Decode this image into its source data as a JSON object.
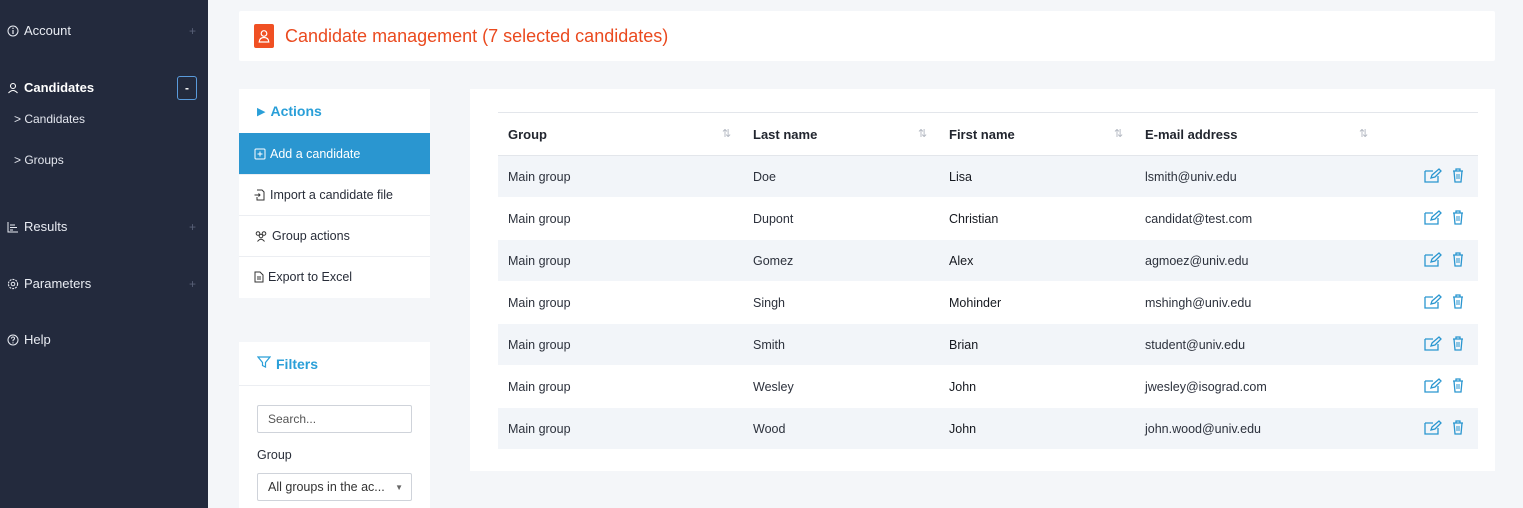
{
  "sidebar": {
    "account": "Account",
    "candidates": "Candidates",
    "candidates_sub": "> Candidates",
    "groups_sub": "> Groups",
    "results": "Results",
    "parameters": "Parameters",
    "help": "Help",
    "expand_symbol": "+",
    "collapse_symbol": "-"
  },
  "header": {
    "title": "Candidate management (7 selected candidates)"
  },
  "actions": {
    "title": "Actions",
    "items": [
      {
        "label": "Add a candidate",
        "icon": "plus-square-icon"
      },
      {
        "label": "Import a candidate file",
        "icon": "import-file-icon"
      },
      {
        "label": "Group actions",
        "icon": "users-icon"
      },
      {
        "label": "Export to Excel",
        "icon": "document-icon"
      }
    ]
  },
  "filters": {
    "title": "Filters",
    "search_placeholder": "Search...",
    "group_label": "Group",
    "group_value": "All groups in the ac..."
  },
  "table": {
    "columns": [
      "Group",
      "Last name",
      "First name",
      "E-mail address"
    ],
    "rows": [
      {
        "group": "Main group",
        "last": "Doe",
        "first": "Lisa",
        "email": "lsmith@univ.edu"
      },
      {
        "group": "Main group",
        "last": "Dupont",
        "first": "Christian",
        "email": "candidat@test.com"
      },
      {
        "group": "Main group",
        "last": "Gomez",
        "first": "Alex",
        "email": "agmoez@univ.edu"
      },
      {
        "group": "Main group",
        "last": "Singh",
        "first": "Mohinder",
        "email": "mshingh@univ.edu"
      },
      {
        "group": "Main group",
        "last": "Smith",
        "first": "Brian",
        "email": "student@univ.edu"
      },
      {
        "group": "Main group",
        "last": "Wesley",
        "first": "John",
        "email": "jwesley@isograd.com"
      },
      {
        "group": "Main group",
        "last": "Wood",
        "first": "John",
        "email": "john.wood@univ.edu"
      }
    ]
  },
  "colors": {
    "sidebar_bg": "#232a3d",
    "accent_orange": "#ea4a1f",
    "accent_blue": "#2a96d0"
  }
}
